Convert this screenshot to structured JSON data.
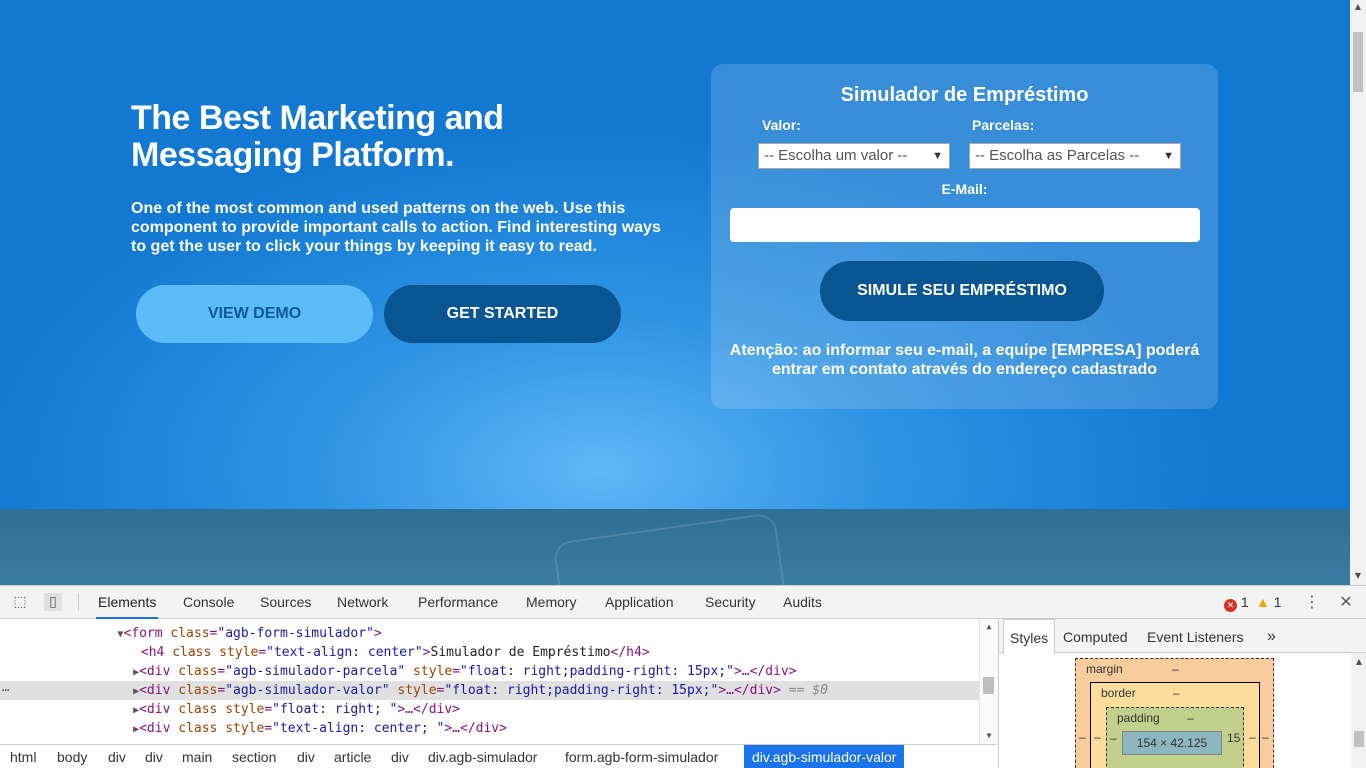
{
  "hero": {
    "title": "The Best Marketing and Messaging Platform.",
    "text": "One of the most common and used patterns on the web. Use this component to provide important calls to action. Find interesting ways to get the user to click your things by keeping it easy to read.",
    "demo_button": "VIEW DEMO",
    "start_button": "GET STARTED"
  },
  "simulator": {
    "title": "Simulador de Empréstimo",
    "valor_label": "Valor:",
    "valor_select": "-- Escolha um valor --",
    "parcelas_label": "Parcelas:",
    "parcelas_select": "-- Escolha as Parcelas --",
    "email_label": "E-Mail:",
    "email_value": "",
    "submit_button": "SIMULE SEU EMPRÉSTIMO",
    "note": "Atenção: ao informar seu e-mail, a equipe [EMPRESA] poderá entrar em contato através do endereço cadastrado"
  },
  "devtools": {
    "tabs": [
      "Elements",
      "Console",
      "Sources",
      "Network",
      "Performance",
      "Memory",
      "Application",
      "Security",
      "Audits"
    ],
    "active_tab": "Elements",
    "errors": "1",
    "warnings": "1",
    "dom_lines": [
      {
        "tag_open": "<form ",
        "attr": "class",
        "val": "\"agb-form-simulador\"",
        "rest": ">"
      },
      {
        "tag_open": "<h4 ",
        "attr": "class style",
        "val": "\"text-align: center\"",
        "text": "Simulador de Empréstimo",
        "close": "</h4>"
      },
      {
        "tag_open": "<div ",
        "attr": "class",
        "val": "\"agb-simulador-parcela\"",
        "attr2": "style",
        "val2": "\"float: right;padding-right: 15px;\"",
        "rest": ">…</div>"
      },
      {
        "tag_open": "<div ",
        "attr": "class",
        "val": "\"agb-simulador-valor\"",
        "attr2": "style",
        "val2": "\"float: right;padding-right: 15px;\"",
        "rest": ">…</div>",
        "marker": "== $0"
      },
      {
        "tag_open": "<div ",
        "attr": "class style",
        "val": "\"float: right; \"",
        "rest": ">…</div>"
      },
      {
        "tag_open": "<div ",
        "attr": "class style",
        "val": "\"text-align: center; \"",
        "rest": ">…</div>"
      }
    ],
    "breadcrumbs": [
      "html",
      "body",
      "div",
      "div",
      "main",
      "section",
      "div",
      "article",
      "div",
      "div.agb-simulador",
      "form.agb-form-simulador",
      "div.agb-simulador-valor"
    ],
    "styles_tabs": [
      "Styles",
      "Computed",
      "Event Listeners"
    ],
    "box_model": {
      "margin_label": "margin",
      "border_label": "border",
      "padding_label": "padding",
      "content_size": "154 × 42.125",
      "padding_right": "15",
      "dash": "–"
    }
  }
}
